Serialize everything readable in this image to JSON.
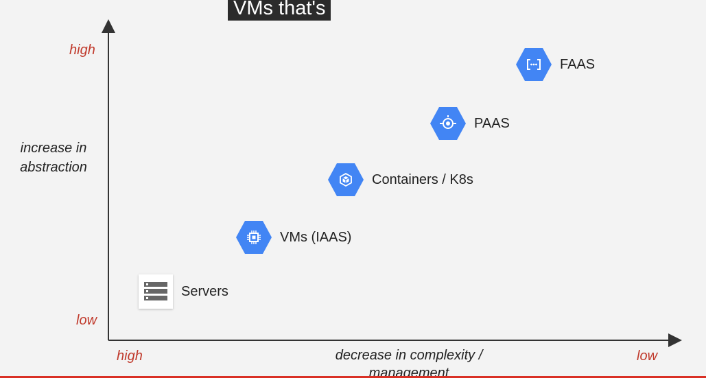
{
  "caption": "VMs that's",
  "y_axis": {
    "high": "high",
    "low": "low",
    "label": "increase in abstraction"
  },
  "x_axis": {
    "high": "high",
    "low": "low",
    "label": "decrease in complexity / management"
  },
  "nodes": [
    {
      "label": "Servers",
      "icon": "server-icon"
    },
    {
      "label": "VMs (IAAS)",
      "icon": "compute-chip-icon"
    },
    {
      "label": "Containers / K8s",
      "icon": "container-cube-icon"
    },
    {
      "label": "PAAS",
      "icon": "app-engine-icon"
    },
    {
      "label": "FAAS",
      "icon": "cloud-functions-icon"
    }
  ],
  "colors": {
    "hexagon": "#4285f4",
    "accent_label": "#c0392b",
    "bottom_rule": "#d93025"
  }
}
